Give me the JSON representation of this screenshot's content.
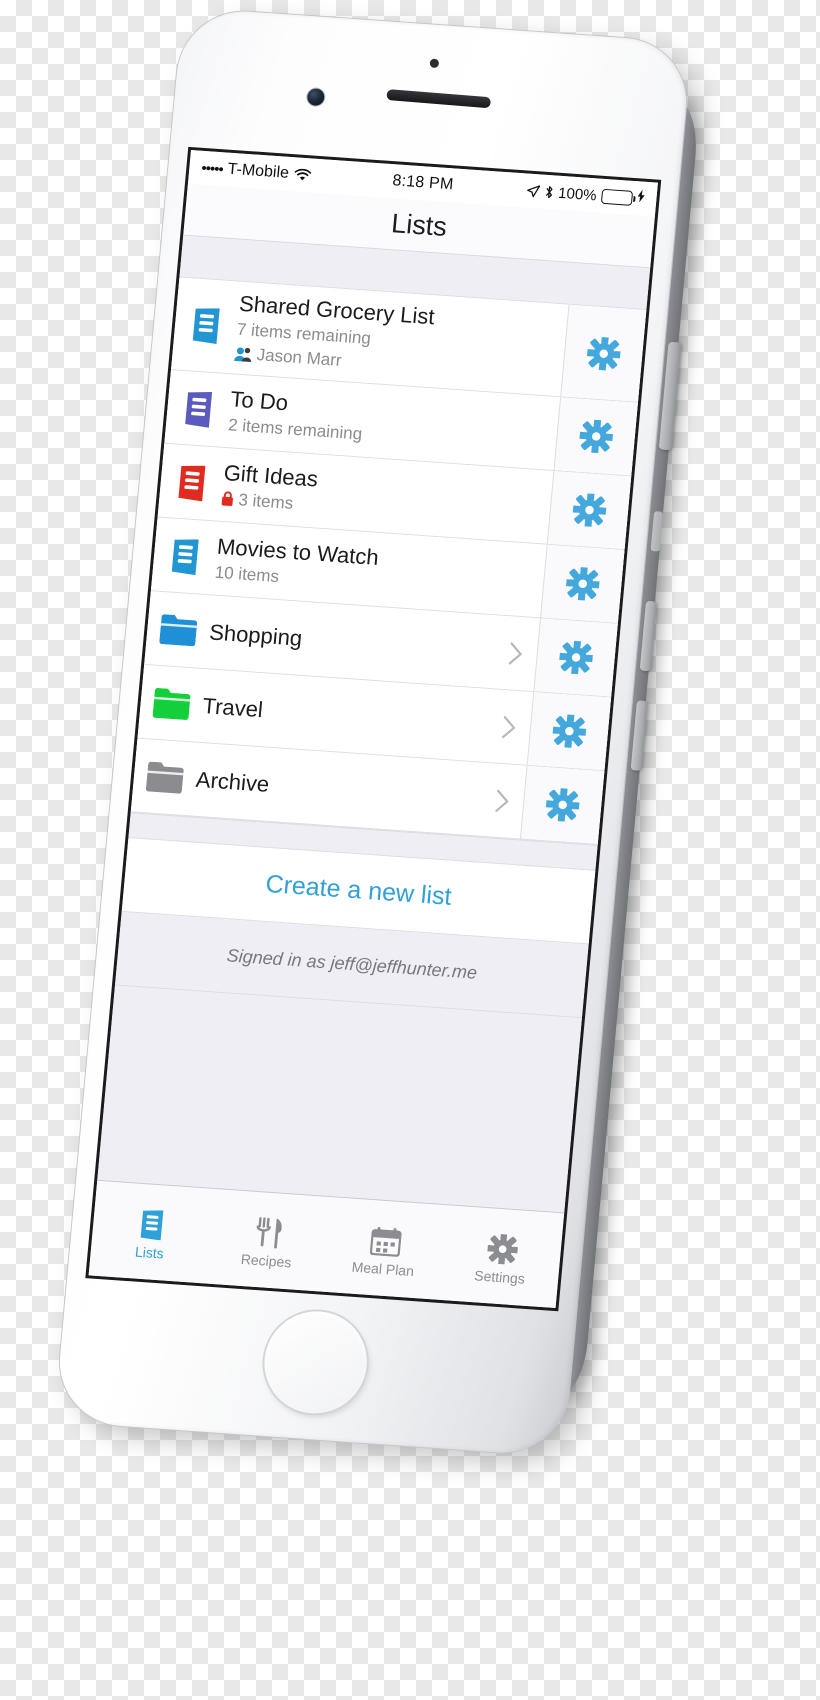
{
  "device": {
    "name": "iphone-white-silver",
    "home_button": "home-button",
    "colors": {
      "accent": "#2fa0d8",
      "list_blue": "#2196d3",
      "list_purple": "#5b5bbd",
      "list_red": "#e02b20",
      "folder_blue": "#1f8fd6",
      "folder_green": "#12cf3a",
      "folder_gray": "#8b8b90",
      "battery_green": "#3ad64b",
      "gear_blue": "#45a8dd",
      "panel_bg": "#eeeef4"
    }
  },
  "statusbar": {
    "signal_dots": "•••••",
    "carrier": "T-Mobile",
    "wifi_icon": "wifi-icon",
    "time": "8:18 PM",
    "location_icon": "location-arrow-icon",
    "bluetooth_icon": "bluetooth-icon",
    "battery_percent": "100%",
    "battery_icon": "battery-full-icon",
    "charging_icon": "lightning-bolt-icon"
  },
  "navbar": {
    "title": "Lists"
  },
  "lists": [
    {
      "icon": "list-icon",
      "icon_color": "#2196d3",
      "title": "Shared Grocery List",
      "subtitle": "7 items remaining",
      "shared_icon": "people-icon",
      "shared_with": "Jason Marr",
      "locked": false,
      "has_chevron": false,
      "gear": "gear-icon"
    },
    {
      "icon": "list-icon",
      "icon_color": "#5b5bbd",
      "title": "To Do",
      "subtitle": "2 items remaining",
      "shared_icon": null,
      "shared_with": null,
      "locked": false,
      "has_chevron": false,
      "gear": "gear-icon"
    },
    {
      "icon": "list-icon",
      "icon_color": "#e02b20",
      "title": "Gift Ideas",
      "subtitle": "3 items",
      "shared_icon": null,
      "shared_with": null,
      "locked": true,
      "lock_icon": "lock-icon",
      "has_chevron": false,
      "gear": "gear-icon"
    },
    {
      "icon": "list-icon",
      "icon_color": "#2196d3",
      "title": "Movies to Watch",
      "subtitle": "10 items",
      "shared_icon": null,
      "shared_with": null,
      "locked": false,
      "has_chevron": false,
      "gear": "gear-icon"
    },
    {
      "icon": "folder-icon",
      "icon_color": "#1f8fd6",
      "title": "Shopping",
      "subtitle": null,
      "locked": false,
      "has_chevron": true,
      "chevron_icon": "chevron-right-icon",
      "gear": "gear-icon"
    },
    {
      "icon": "folder-icon",
      "icon_color": "#12cf3a",
      "title": "Travel",
      "subtitle": null,
      "locked": false,
      "has_chevron": true,
      "chevron_icon": "chevron-right-icon",
      "gear": "gear-icon"
    },
    {
      "icon": "folder-icon",
      "icon_color": "#8b8b90",
      "title": "Archive",
      "subtitle": null,
      "locked": false,
      "has_chevron": true,
      "chevron_icon": "chevron-right-icon",
      "gear": "gear-icon"
    }
  ],
  "footer": {
    "create_label": "Create a new list",
    "signed_in_label": "Signed in as jeff@jeffhunter.me"
  },
  "tabbar": {
    "tabs": [
      {
        "label": "Lists",
        "icon": "list-icon",
        "active": true
      },
      {
        "label": "Recipes",
        "icon": "fork-knife-icon",
        "active": false
      },
      {
        "label": "Meal Plan",
        "icon": "calendar-icon",
        "active": false
      },
      {
        "label": "Settings",
        "icon": "gear-icon",
        "active": false
      }
    ]
  }
}
